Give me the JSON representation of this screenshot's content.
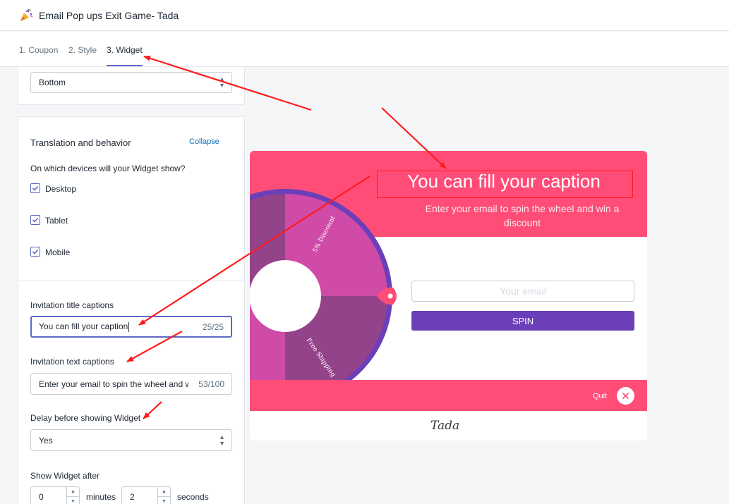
{
  "app": {
    "title": "Email Pop ups Exit Game- Tada",
    "icon": "party-popper-icon"
  },
  "tabs": [
    {
      "label": "1. Coupon",
      "active": false
    },
    {
      "label": "2. Style",
      "active": false
    },
    {
      "label": "3. Widget",
      "active": true
    }
  ],
  "position_select": {
    "value": "Bottom"
  },
  "translation": {
    "heading": "Translation and behavior",
    "collapse_label": "Collapse",
    "devices_question": "On which devices will your Widget show?",
    "devices": [
      {
        "label": "Desktop",
        "checked": true
      },
      {
        "label": "Tablet",
        "checked": true
      },
      {
        "label": "Mobile",
        "checked": true
      }
    ],
    "title_caption_label": "Invitation title captions",
    "title_caption_value": "You can fill your caption",
    "title_caption_count": "25/25",
    "text_caption_label": "Invitation text captions",
    "text_caption_value": "Enter your email to spin the wheel and win a discount",
    "text_caption_count": "53/100",
    "delay_label": "Delay before showing Widget",
    "delay_value": "Yes",
    "show_after_label": "Show Widget after",
    "minutes_value": "0",
    "minutes_unit": "minutes",
    "seconds_value": "2",
    "seconds_unit": "seconds"
  },
  "preview": {
    "title": "You can fill your caption",
    "text": "Enter your email to spin the wheel and win a discount",
    "wheel_segments": [
      "5% Discount",
      "Free Shipping"
    ],
    "email_placeholder": "Your email",
    "spin_label": "SPIN",
    "quit_label": "Quit",
    "logo_text": "Tada",
    "colors": {
      "header": "#ff4d78",
      "spin_button": "#6b3fb8",
      "wheel_segment_1": "#d04aa8",
      "wheel_segment_2": "#93438a",
      "wheel_rim": "#6b3fb8"
    }
  },
  "annotation_color": "#ff1a1a"
}
